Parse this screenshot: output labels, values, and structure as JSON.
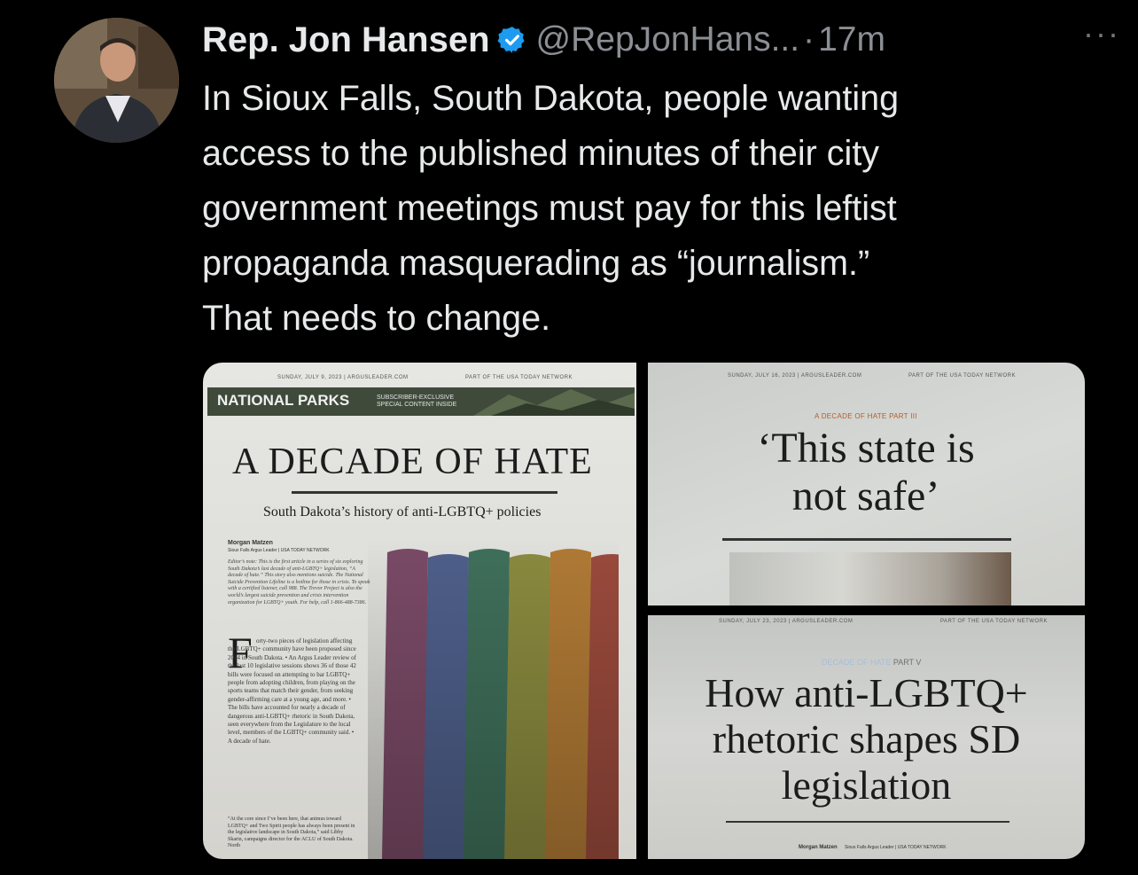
{
  "tweet": {
    "author_name": "Rep. Jon Hansen",
    "handle": "@RepJonHans...",
    "separator": "·",
    "time": "17m",
    "more_label": "···",
    "text": "In Sioux Falls, South Dakota, people wanting\naccess to the published minutes of their city\ngovernment meetings must pay for this leftist\npropaganda masquerading as “journalism.”\nThat needs to change.",
    "verified_icon": "verified-badge-icon",
    "verified_color": "#1d9bf0"
  },
  "media": {
    "panel1": {
      "dateline": "SUNDAY, JULY 9, 2023 | ARGUSLEADER.COM",
      "network": "PART OF THE USA TODAY NETWORK",
      "section_title": "NATIONAL PARKS",
      "section_sub": "SUBSCRIBER-EXCLUSIVE\nSPECIAL CONTENT INSIDE",
      "headline": "A DECADE OF HATE",
      "subheadline": "South Dakota’s history of anti-LGBTQ+ policies",
      "byline": "Morgan Matzen",
      "byline_sub": "Sioux Falls Argus Leader | USA TODAY NETWORK",
      "editors_note": "Editor’s note: This is the first article in a series of six exploring South Dakota’s last decade of anti-LGBTQ+ legislation, “A decade of hate.” This story also mentions suicide. The National Suicide Prevention Lifeline is a hotline for those in crisis. To speak with a certified listener, call 988. The Trevor Project is also the world’s largest suicide prevention and crisis intervention organization for LGBTQ+ youth. For help, call 1-866-488-7386.",
      "dropcap": "F",
      "body": "orty-two pieces of legislation affecting the LGBTQ+ community have been proposed since 2014 in South Dakota. • An Argus Leader review of the last 10 legislative sessions shows 36 of those 42 bills were focused on attempting to bar LGBTQ+ people from adopting children, from playing on the sports teams that match their gender, from seeking gender-affirming care at a young age, and more. • The bills have accounted for nearly a decade of dangerous anti-LGBTQ+ rhetoric in South Dakota, seen everywhere from the Legislature to the local level, members of the LGBTQ+ community said. • A decade of hate.",
      "quote": "“At the core since I’ve been here, that animus toward LGBTQ+ and Two Spirit people has always been present in the legislative landscape in South Dakota,” said Libby Skarin, campaigns director for the ACLU of South Dakota. North"
    },
    "panel2": {
      "dateline": "SUNDAY, JULY 16, 2023 | ARGUSLEADER.COM",
      "network": "PART OF THE USA TODAY NETWORK",
      "kicker": "A DECADE OF HATE   PART III",
      "headline": "‘This state is not safe’"
    },
    "panel3": {
      "dateline": "SUNDAY, JULY 23, 2023 | ARGUSLEADER.COM",
      "network": "PART OF THE USA TODAY NETWORK",
      "kicker_main": "DECADE OF HATE",
      "kicker_part": "PART V",
      "headline": "How anti-LGBTQ+ rhetoric shapes SD legislation",
      "byline": "Morgan Matzen",
      "byline_sub": "Sioux Falls Argus Leader | USA TODAY NETWORK"
    },
    "flag_colors": [
      "#7a4a66",
      "#4e5f8a",
      "#3f6f5a",
      "#8a8a3f",
      "#b07a35",
      "#9a4a3c"
    ]
  }
}
